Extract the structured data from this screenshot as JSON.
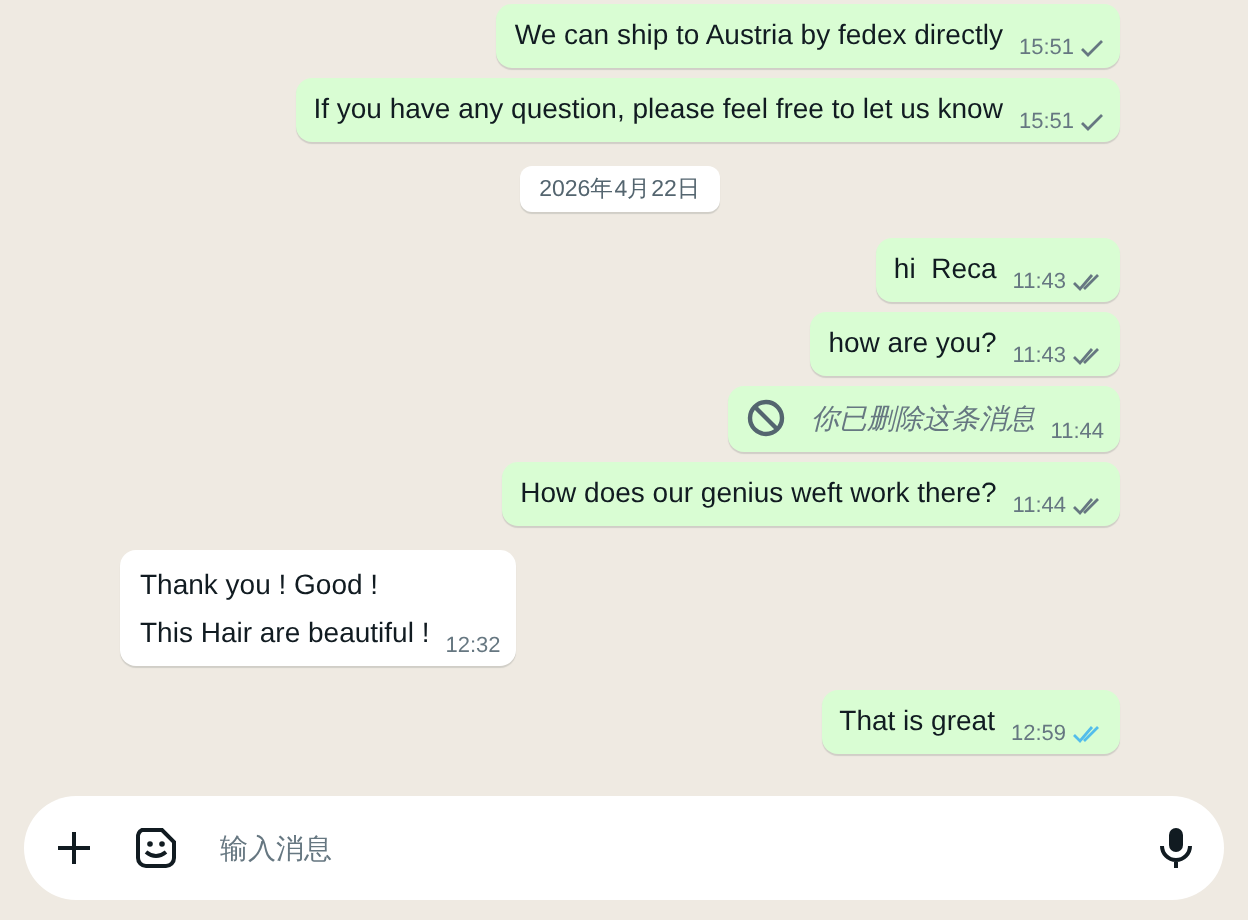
{
  "messages": [
    {
      "kind": "text",
      "outgoing": true,
      "text": "We can ship to Austria by fedex directly",
      "time": "15:51",
      "delivered": false,
      "read": false
    },
    {
      "kind": "text",
      "outgoing": true,
      "text": "If you have any question, please feel free to let us know",
      "time": "15:51",
      "delivered": false,
      "read": false
    },
    {
      "kind": "date",
      "text": "2026年4月22日"
    },
    {
      "kind": "text",
      "outgoing": true,
      "text": "hi  Reca",
      "time": "11:43",
      "delivered": true,
      "read": false
    },
    {
      "kind": "text",
      "outgoing": true,
      "text": "how are you?",
      "time": "11:43",
      "delivered": true,
      "read": false
    },
    {
      "kind": "deleted",
      "outgoing": true,
      "text": "你已删除这条消息",
      "time": "11:44"
    },
    {
      "kind": "text",
      "outgoing": true,
      "text": "How does our genius weft work there?",
      "time": "11:44",
      "delivered": true,
      "read": false
    },
    {
      "kind": "text",
      "outgoing": false,
      "lines": [
        "Thank you ! Good !",
        "This Hair are beautiful !"
      ],
      "time": "12:32"
    },
    {
      "kind": "text",
      "outgoing": true,
      "text": "That is great",
      "time": "12:59",
      "delivered": true,
      "read": true
    }
  ],
  "composer": {
    "placeholder": "输入消息"
  }
}
